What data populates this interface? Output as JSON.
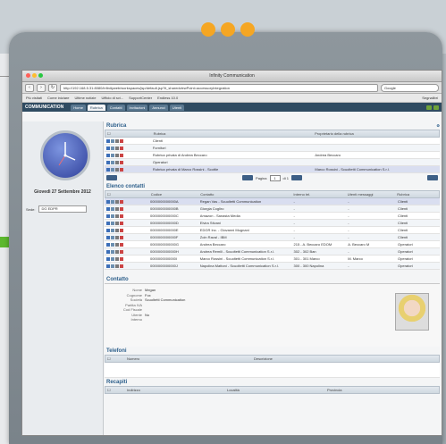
{
  "window": {
    "title": "Infinity Communication",
    "url": "http://192.168.5.31:8080/infinityweb/workspaces/jsp/default.jsp?it_sharedviewPoint=accessoryIntegration",
    "search_placeholder": "Google"
  },
  "bookmarks": [
    "Più visitati",
    "Come iniziare",
    "Ultime notizie",
    "Ufficio di svi...",
    "SupportCenter",
    "Endless 10.0",
    "Segnalibri"
  ],
  "app": {
    "logo": "COMMUNICATION",
    "tabs": [
      {
        "label": "Home",
        "active": false
      },
      {
        "label": "Rubrica",
        "active": true
      },
      {
        "label": "Contatti",
        "active": false
      },
      {
        "label": "Invitazioni",
        "active": false
      },
      {
        "label": "Annunci",
        "active": false
      },
      {
        "label": "Utenti",
        "active": false
      }
    ]
  },
  "sidebar": {
    "date": "Giovedì 27 Settembre 2012",
    "sede_label": "Sede:",
    "sede_value": "DG EDPR"
  },
  "rubrica": {
    "title": "Rubrica",
    "columns": [
      "Rubrica",
      "Proprietario della rubrica"
    ],
    "rows": [
      {
        "name": "Clienti",
        "owner": ""
      },
      {
        "name": "Fornitori",
        "owner": ""
      },
      {
        "name": "Rubrica privata di Andrea Beccaro",
        "owner": "Andrea Beccaro"
      },
      {
        "name": "Operatori",
        "owner": ""
      },
      {
        "name": "Rubrica privata di Marco Rossini - Scottie",
        "owner": "Marco Rossini - Scuoltetti Communication S.r.l."
      }
    ],
    "pager_label": "Pagina",
    "pager_value": "1",
    "pager_of": "di 1"
  },
  "contatti": {
    "title": "Elenco contatti",
    "columns": [
      "Codice",
      "Contatto",
      "Interno tel.",
      "Utenti messaggi",
      "Rubrica"
    ],
    "rows": [
      {
        "code": "0000000000000A",
        "name": "Regan Vas - Scuoltetti Communication",
        "ext": "-",
        "msg": "-",
        "rubrica": "Clienti"
      },
      {
        "code": "0000000000000B",
        "name": "Giorgia Cogliro",
        "ext": "-",
        "msg": "-",
        "rubrica": "Clienti"
      },
      {
        "code": "0000000000000C",
        "name": "Amazon - Sanasta Media",
        "ext": "-",
        "msg": "-",
        "rubrica": "Clienti"
      },
      {
        "code": "0000000000000D",
        "name": "Elvira Stivani",
        "ext": "-",
        "msg": "-",
        "rubrica": "Clienti"
      },
      {
        "code": "0000000000000E",
        "name": "EDGR Inc. - Giovanni Mugnani",
        "ext": "-",
        "msg": "-",
        "rubrica": "Clienti"
      },
      {
        "code": "0000000000000F",
        "name": "Zoln Raval - IBM",
        "ext": "-",
        "msg": "-",
        "rubrica": "Clienti"
      },
      {
        "code": "0000000000000G",
        "name": "Andrea Beccaro",
        "ext": "215 - A. Beccaro EDOM",
        "msg": "A. Beccaro M",
        "rubrica": "Operatori"
      },
      {
        "code": "0000000000000H",
        "name": "Andrea Remili - Scuoltetti Communication S.r.l.",
        "ext": "302 - 302 Ban",
        "msg": "-",
        "rubrica": "Operatori"
      },
      {
        "code": "0000000000000I",
        "name": "Marco Rossini - Scuoltetti Communication S.r.l.",
        "ext": "301 - 301 Marco",
        "msg": "M. Marco",
        "rubrica": "Operatori"
      },
      {
        "code": "0000000000000J",
        "name": "Napolina Mattoni - Scuoltetti Communication S.r.l.",
        "ext": "300 - 300 Napolina",
        "msg": "-",
        "rubrica": "Operatori"
      }
    ]
  },
  "dettaglio": {
    "title": "Contatto",
    "fields": [
      {
        "k": "Nome",
        "v": "Megan"
      },
      {
        "k": "Cognome",
        "v": "Fox"
      },
      {
        "k": "Società",
        "v": "Scuoltetti Communication"
      },
      {
        "k": "Partita IVA",
        "v": ""
      },
      {
        "k": "Cod Fiscale",
        "v": ""
      },
      {
        "k": "Utente",
        "v": "No"
      },
      {
        "k": "Interno",
        "v": ""
      }
    ],
    "telefoni_title": "Telefoni",
    "telefoni_cols": [
      "Numero",
      "Descrizione"
    ],
    "recapiti_title": "Recapiti",
    "recapiti_cols": [
      "Indirizzo",
      "Località",
      "Provincia"
    ]
  }
}
